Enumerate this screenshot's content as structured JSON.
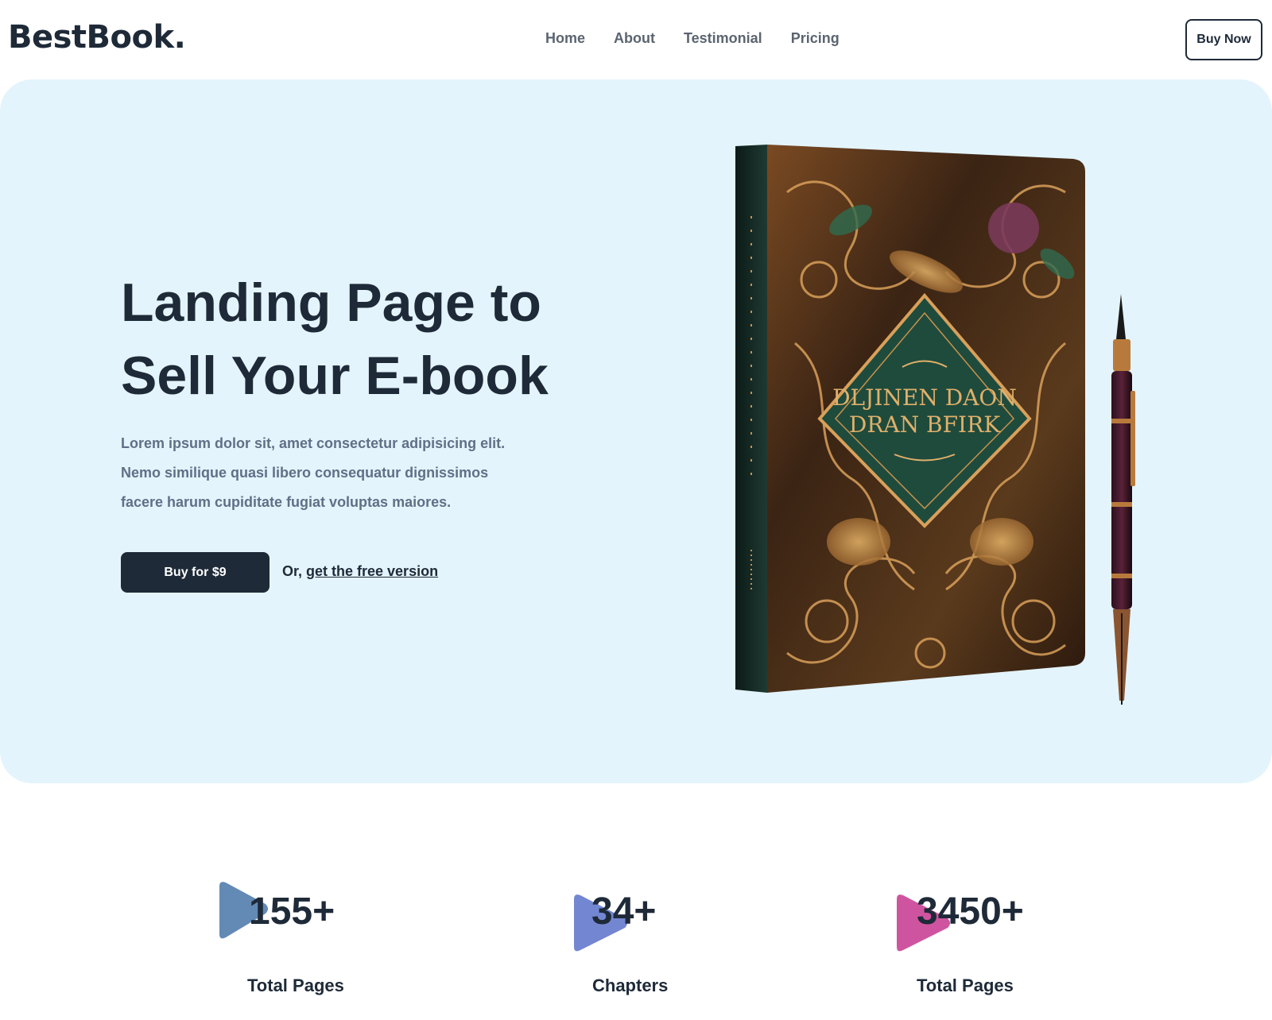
{
  "nav": {
    "logo": "BestBook.",
    "links": [
      "Home",
      "About",
      "Testimonial",
      "Pricing"
    ],
    "buy_label": "Buy Now"
  },
  "hero": {
    "title_line1": "Landing Page to",
    "title_line2": "Sell Your E-book",
    "description": "Lorem ipsum dolor sit, amet consectetur adipisicing elit. Nemo similique quasi libero consequatur dignissimos facere harum cupiditate fugiat voluptas maiores.",
    "cta_label": "Buy for $9",
    "alt_prefix": "Or, ",
    "alt_link": "get the free version",
    "book_cover_line1": "DLJINEN DAON",
    "book_cover_line2": "DRAN BFIRK"
  },
  "stats": [
    {
      "number": "155+",
      "label": "Total Pages",
      "color": "#5b84b1"
    },
    {
      "number": "34+",
      "label": "Chapters",
      "color": "#6c7fd0"
    },
    {
      "number": "3450+",
      "label": "Total Pages",
      "color": "#cc4b9b"
    }
  ],
  "colors": {
    "dark": "#1e2a38",
    "hero_bg": "#e4f4fc",
    "muted_text": "#5f7087"
  }
}
